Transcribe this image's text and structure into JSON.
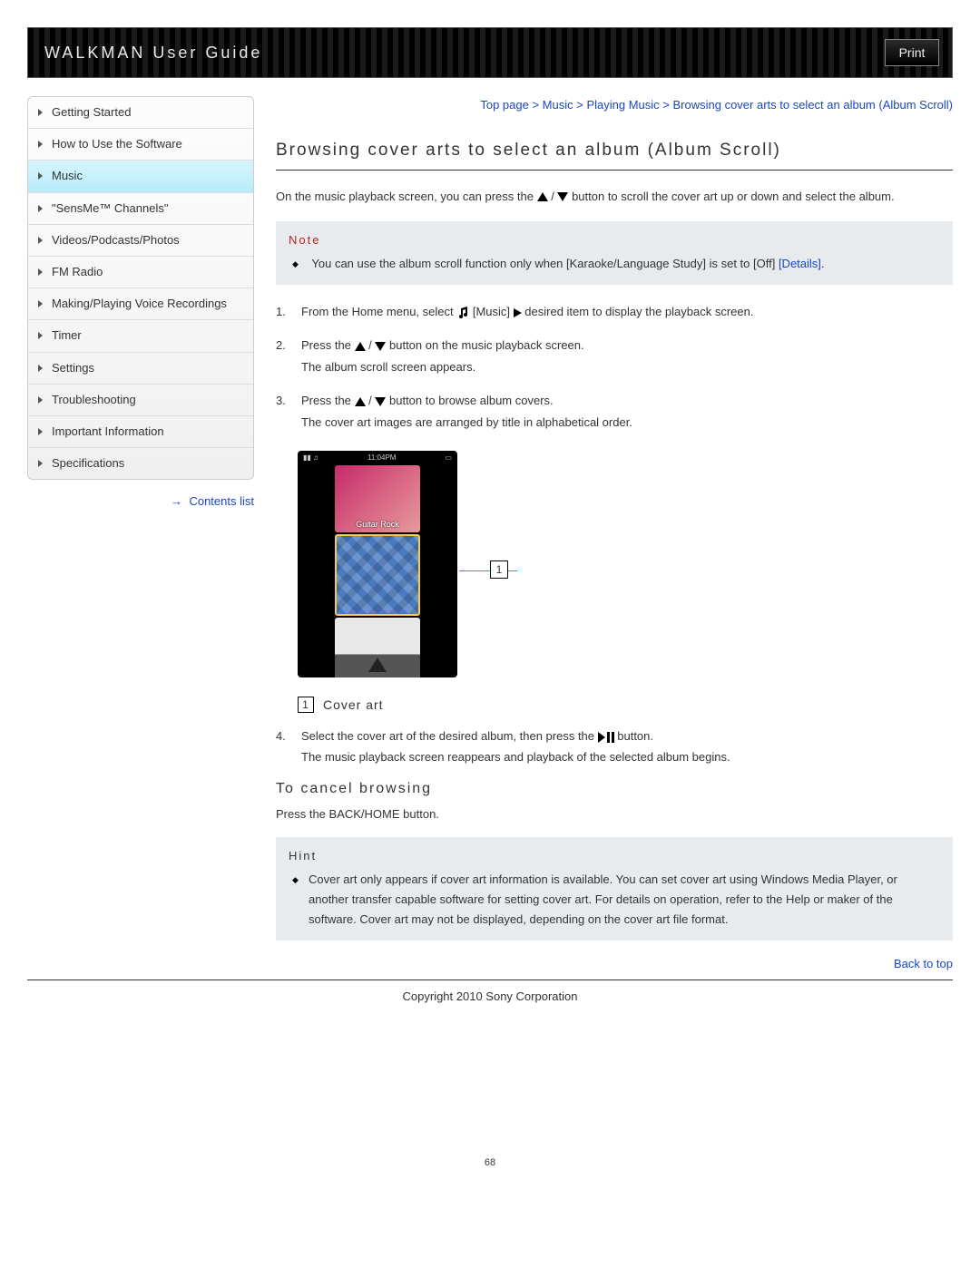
{
  "header": {
    "title": "WALKMAN User Guide",
    "print": "Print"
  },
  "breadcrumb": {
    "items": [
      "Top page",
      "Music",
      "Playing Music",
      "Browsing cover arts to select an album (Album Scroll)"
    ]
  },
  "sidebar": {
    "items": [
      {
        "label": "Getting Started"
      },
      {
        "label": "How to Use the Software"
      },
      {
        "label": "Music",
        "active": true
      },
      {
        "label": "\"SensMe™ Channels\""
      },
      {
        "label": "Videos/Podcasts/Photos"
      },
      {
        "label": "FM Radio"
      },
      {
        "label": "Making/Playing Voice Recordings"
      },
      {
        "label": "Timer"
      },
      {
        "label": "Settings"
      },
      {
        "label": "Troubleshooting"
      },
      {
        "label": "Important Information"
      },
      {
        "label": "Specifications"
      }
    ],
    "contents_list": "Contents list"
  },
  "page": {
    "title": "Browsing cover arts to select an album (Album Scroll)",
    "intro_a": "On the music playback screen, you can press the ",
    "intro_b": " button to scroll the cover art up or down and select the album.",
    "note": {
      "title": "Note",
      "text_a": "You can use the album scroll function only when [Karaoke/Language Study] is set to [Off] ",
      "details": "[Details]",
      "text_b": "."
    },
    "steps": {
      "s1_a": "From the Home menu, select ",
      "s1_b": "[Music] ",
      "s1_c": " desired item to display the playback screen.",
      "s2_a": "Press the ",
      "s2_b": " button on the music playback screen.",
      "s2_c": "The album scroll screen appears.",
      "s3_a": "Press the ",
      "s3_b": " button to browse album covers.",
      "s3_c": "The cover art images are arranged by title in alphabetical order.",
      "s4_a": "Select the cover art of the desired album, then press the ",
      "s4_b": " button.",
      "s4_c": "The music playback screen reappears and playback of the selected album begins."
    },
    "device": {
      "time": "11:04PM",
      "album_label": "Guitar Rock",
      "callout": "1"
    },
    "legend": {
      "num": "1",
      "label": "Cover art"
    },
    "cancel": {
      "title": "To cancel browsing",
      "text": "Press the BACK/HOME button."
    },
    "hint": {
      "title": "Hint",
      "text": "Cover art only appears if cover art information is available. You can set cover art using Windows Media Player, or another transfer capable software for setting cover art. For details on operation, refer to the Help or maker of the software. Cover art may not be displayed, depending on the cover art file format."
    },
    "back_to_top": "Back to top",
    "copyright": "Copyright 2010 Sony Corporation",
    "page_number": "68"
  }
}
